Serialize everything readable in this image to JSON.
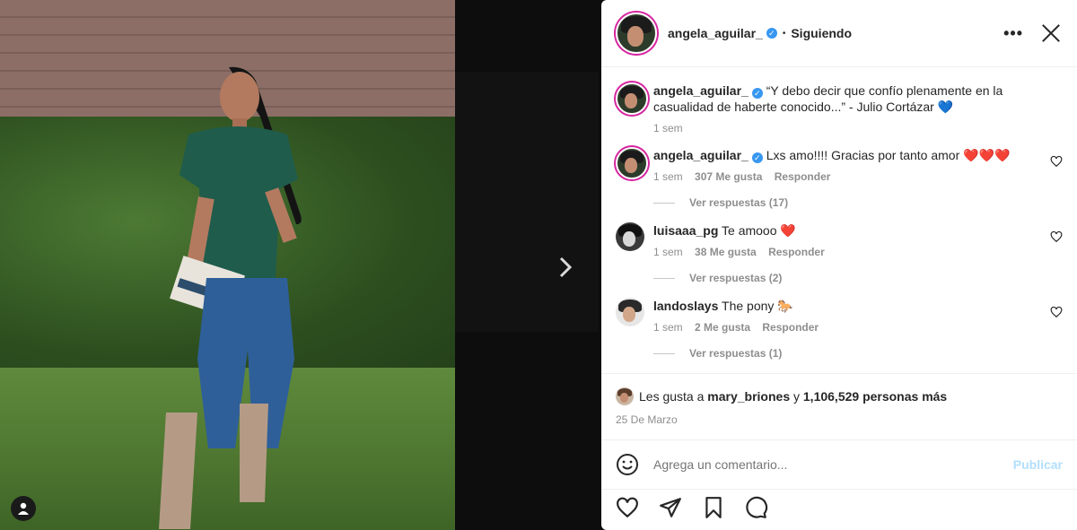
{
  "post": {
    "username": "angela_aguilar_",
    "follow_status": "Siguiendo",
    "caption": "“Y debo decir que confío plenamente en la casualidad de haberte conocido...” - Julio Cortázar 💙",
    "caption_age": "1 sem"
  },
  "comments": [
    {
      "username": "angela_aguilar_",
      "text": "Lxs amo!!!! Gracias por tanto amor ❤️❤️❤️",
      "age": "1 sem",
      "likes": "307 Me gusta",
      "reply_label": "Responder",
      "view_replies": "Ver respuestas (17)"
    },
    {
      "username": "luisaaa_pg",
      "text": "Te amooo ❤️",
      "age": "1 sem",
      "likes": "38 Me gusta",
      "reply_label": "Responder",
      "view_replies": "Ver respuestas (2)"
    },
    {
      "username": "landoslays",
      "text": "The pony 🐎",
      "age": "1 sem",
      "likes": "2 Me gusta",
      "reply_label": "Responder",
      "view_replies": "Ver respuestas (1)"
    }
  ],
  "likes_summary": {
    "prefix": "Les gusta a",
    "user": "mary_briones",
    "middle": "y",
    "count": "1,106,529 personas más"
  },
  "date": "25 De Marzo",
  "add_comment": {
    "placeholder": "Agrega un comentario...",
    "post_label": "Publicar"
  },
  "icons": {
    "more": "more-options-icon",
    "close": "close-icon",
    "next": "chevron-right-icon",
    "verified": "verified-badge-icon"
  },
  "colors": {
    "verified": "#3897f0",
    "post_disabled": "#b2dffc",
    "story_ring": "#d6249f"
  }
}
